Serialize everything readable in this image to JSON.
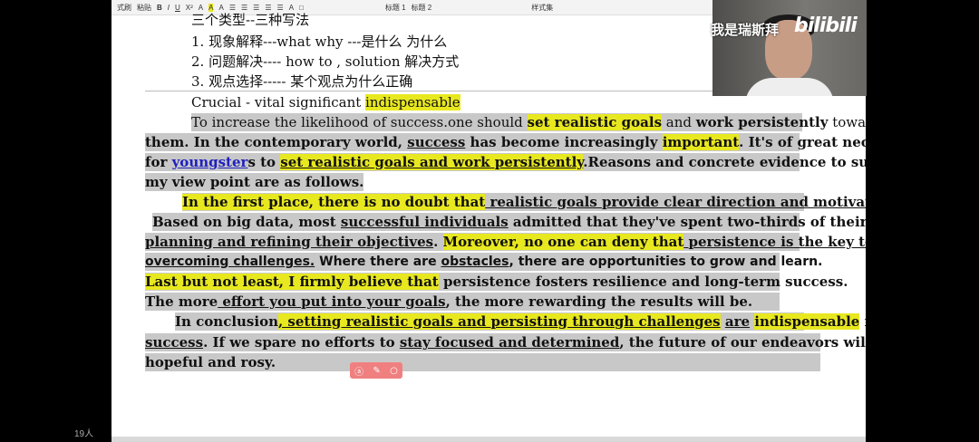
{
  "toolbar": {
    "items": [
      "式刷",
      "粘贴",
      "B",
      "I",
      "U",
      "X²",
      "A",
      "A",
      "A",
      "☰",
      "☰",
      "☰",
      "☰",
      "☰",
      "A",
      "□",
      "标题 1",
      "标题 2",
      "样式集"
    ]
  },
  "header_cn": {
    "heading": "三个类型--三种写法",
    "item1": "1.  现象解释---what    why    ---是什么  为什么",
    "item2": "2.  问题解决---- how to , solution  解决方式",
    "item3": "3.  观点选择-----  某个观点为什么正确"
  },
  "vocab": {
    "words": "Crucial      - vital      significant   ",
    "highlight": "indispensable"
  },
  "essay": {
    "p1a": "To increase the likelihood of success.one should ",
    "p1b": "set realistic goals",
    "p1c": " and ",
    "p1d": "work persistently",
    "p1e": " towards",
    "p2a": "them. ",
    "p2b": "In the contemporary world, ",
    "p2c": "success",
    "p2d": " has become increasingly ",
    "p2e": "important",
    "p2f": ". It's of great necessity",
    "p3a": "for ",
    "p3b": "youngster",
    "p3c": "s to ",
    "p3d": "set realistic goals and work persistently",
    "p3e": ".Reasons and concrete evidence to support",
    "p4": "my view point are as follows.",
    "p5a": "In the first place, there is no doubt that",
    "p5b": " realistic goals provide clear direction and motivation",
    "p5c": ".",
    "p6a": "Based on big data, most ",
    "p6b": "successful individuals",
    "p6c": " admitted that they've spent two-thirds of their time",
    "p7a": "planning and refining their objectives",
    "p7b": ". ",
    "p7c": "Moreover, no one can deny that",
    "p7d": " persistence is the key to",
    "p8a": "overcoming challenges.",
    "p8b": " Where there are ",
    "p8c": "obstacles",
    "p8d": ", there are opportunities to grow and learn.",
    "p9a": "Last but not least, I firmly believe that",
    "p9b": " persistence fosters resilience and long-term success.",
    "p10a": "The more",
    "p10b": " effort you put into your goals",
    "p10c": ", the more rewarding the results will be.",
    "p11a": "In conclusion",
    "p11b": ", setting realistic goals and persisting through challenges",
    "p11c": " ",
    "p11d": "are",
    "p11e": " ",
    "p11f": "indispensable",
    "p11g": " for",
    "p12a": "success",
    "p12b": ". If we spare no efforts to ",
    "p12c": "stay focused and determined",
    "p12d": ", the future of our endeavors will be both",
    "p13": "hopeful and rosy."
  },
  "stream": {
    "streamer": "我是瑞斯拜",
    "logo": "bilibili",
    "viewers": "19人"
  },
  "mini_toolbar": {
    "icons": [
      "ai-icon",
      "magic-icon",
      "search-icon"
    ]
  },
  "colors": {
    "highlight_yellow": "#e8e820",
    "selection_gray": "#c8c8c8",
    "link_blue": "#2020c0"
  }
}
